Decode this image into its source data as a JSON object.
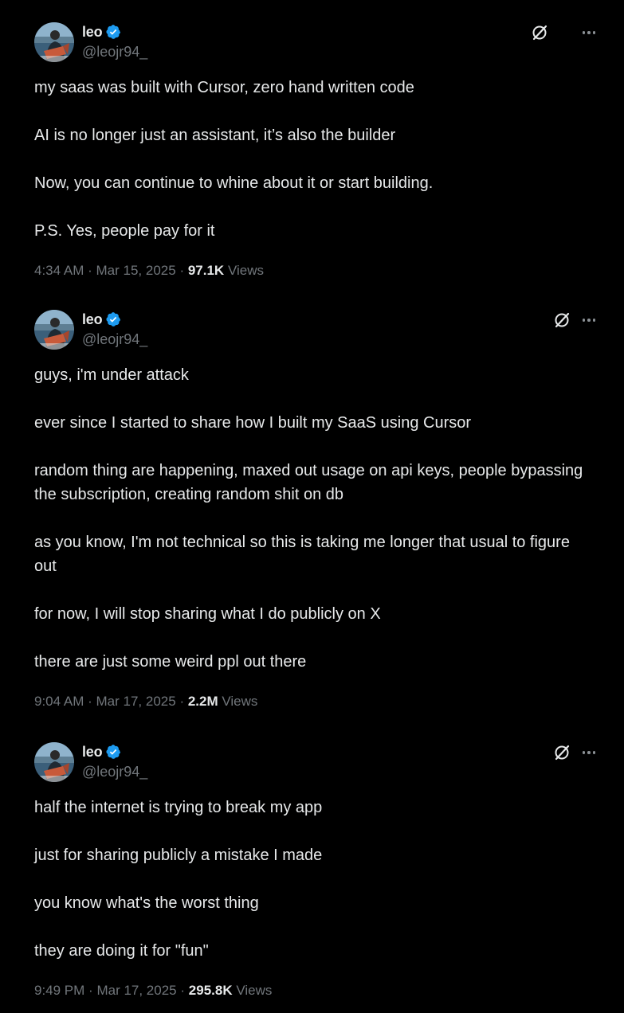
{
  "colors": {
    "background": "#000000",
    "text_primary": "#e7e9ea",
    "text_secondary": "#71767b",
    "verified_blue": "#1d9bf0"
  },
  "tweets": [
    {
      "author": {
        "name": "leo",
        "handle": "@leojr94_",
        "verified": true
      },
      "paragraphs": [
        "my saas was built with Cursor, zero hand written code",
        "AI is no longer just an assistant, it’s also the builder",
        "Now, you can continue to whine about it or start building.",
        "P.S. Yes, people pay for it"
      ],
      "time": "4:34 AM",
      "date": "Mar 15, 2025",
      "views_count": "97.1K",
      "views_label": "Views",
      "separator": "·",
      "icons": [
        "grok-icon",
        "more-icon"
      ]
    },
    {
      "author": {
        "name": "leo",
        "handle": "@leojr94_",
        "verified": true
      },
      "paragraphs": [
        "guys, i'm under attack",
        "ever since I started to share how I built my SaaS using Cursor",
        "random thing are happening, maxed out usage on api keys, people bypassing the subscription, creating random shit on db",
        "as you know, I'm not technical so this is taking me longer that usual to figure out",
        "for now, I will stop sharing what I do publicly on X",
        "there are just some weird ppl out there"
      ],
      "time": "9:04 AM",
      "date": "Mar 17, 2025",
      "views_count": "2.2M",
      "views_label": "Views",
      "separator": "·",
      "icons": [
        "grok-icon",
        "more-icon"
      ]
    },
    {
      "author": {
        "name": "leo",
        "handle": "@leojr94_",
        "verified": true
      },
      "paragraphs": [
        "half the internet is trying to break my app",
        "just for sharing publicly a mistake I made",
        "you know what's the worst thing",
        "they are doing it for \"fun\""
      ],
      "time": "9:49 PM",
      "date": "Mar 17, 2025",
      "views_count": "295.8K",
      "views_label": "Views",
      "separator": "·",
      "icons": [
        "grok-icon",
        "more-icon"
      ]
    }
  ]
}
